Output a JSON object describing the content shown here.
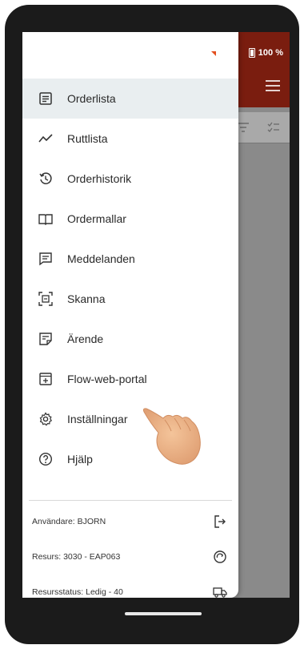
{
  "status": {
    "battery": "100 %"
  },
  "menu": {
    "items": [
      {
        "label": "Orderlista",
        "icon": "list-icon",
        "active": true
      },
      {
        "label": "Ruttlista",
        "icon": "route-icon",
        "active": false
      },
      {
        "label": "Orderhistorik",
        "icon": "history-icon",
        "active": false
      },
      {
        "label": "Ordermallar",
        "icon": "book-icon",
        "active": false
      },
      {
        "label": "Meddelanden",
        "icon": "message-icon",
        "active": false
      },
      {
        "label": "Skanna",
        "icon": "scan-icon",
        "active": false
      },
      {
        "label": "Ärende",
        "icon": "note-icon",
        "active": false
      },
      {
        "label": "Flow-web-portal",
        "icon": "portal-icon",
        "active": false
      },
      {
        "label": "Inställningar",
        "icon": "gear-icon",
        "active": false
      },
      {
        "label": "Hjälp",
        "icon": "help-icon",
        "active": false
      }
    ]
  },
  "footer": {
    "user": "Användare: BJORN",
    "resource": "Resurs: 3030 - EAP063",
    "resource_status": "Resursstatus: Ledig - 40"
  },
  "colors": {
    "appbar": "#7a1d0f",
    "active_item": "#e9eef0",
    "accent": "#e34f1f"
  }
}
